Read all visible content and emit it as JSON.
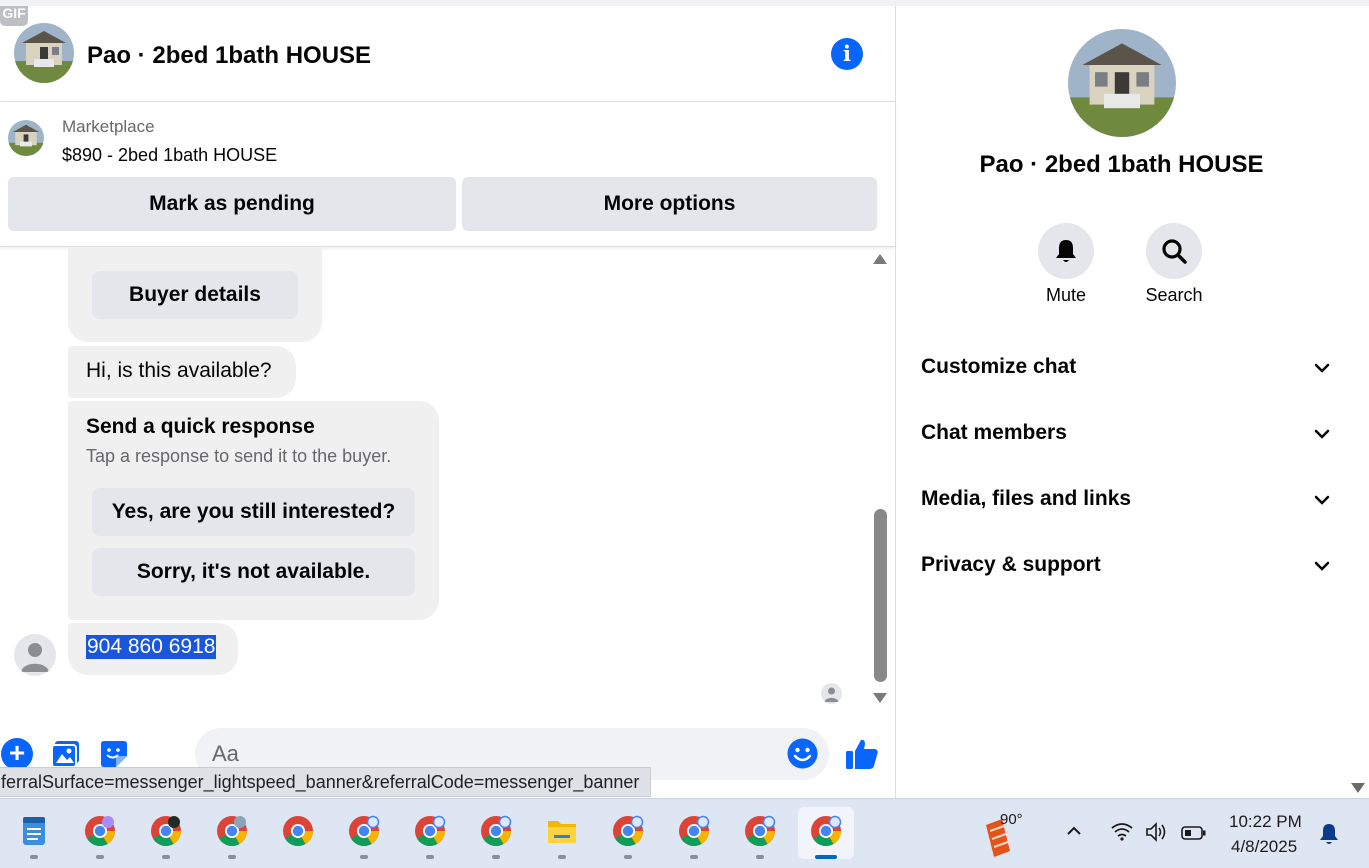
{
  "chat": {
    "title": "Pao · 2bed 1bath HOUSE",
    "info_icon": "info-icon"
  },
  "marketplace": {
    "label": "Marketplace",
    "item": "$890 - 2bed 1bath HOUSE",
    "mark_pending": "Mark as pending",
    "more_options": "More options"
  },
  "messages": {
    "buyer_details": "Buyer details",
    "availability_question": "Hi, is this available?",
    "quick_response_title": "Send a quick response",
    "quick_response_sub": "Tap a response to send it to the buyer.",
    "quick_yes": "Yes, are you still interested?",
    "quick_no": "Sorry, it's not available.",
    "phone_message": "904 860 6918"
  },
  "composer": {
    "placeholder": "Aa",
    "gif_label": "GIF"
  },
  "status_url": "ferralSurface=messenger_lightspeed_banner&referralCode=messenger_banner",
  "right_panel": {
    "title": "Pao · 2bed 1bath HOUSE",
    "mute_label": "Mute",
    "search_label": "Search",
    "sections": [
      "Customize chat",
      "Chat members",
      "Media, files and links",
      "Privacy & support"
    ]
  },
  "taskbar": {
    "weather_temp": "90°",
    "time": "10:22 PM",
    "date": "4/8/2025",
    "apps": [
      "notepad-icon",
      "chrome-icon",
      "chrome-icon",
      "chrome-icon",
      "chrome-icon",
      "chrome-icon",
      "chrome-icon",
      "chrome-icon",
      "file-explorer-icon",
      "chrome-icon",
      "chrome-icon",
      "chrome-icon",
      "chrome-icon"
    ]
  },
  "colors": {
    "accent": "#0866ff",
    "bubble": "#f0f0f0",
    "button": "#e4e6eb",
    "selection": "#1a56db"
  }
}
